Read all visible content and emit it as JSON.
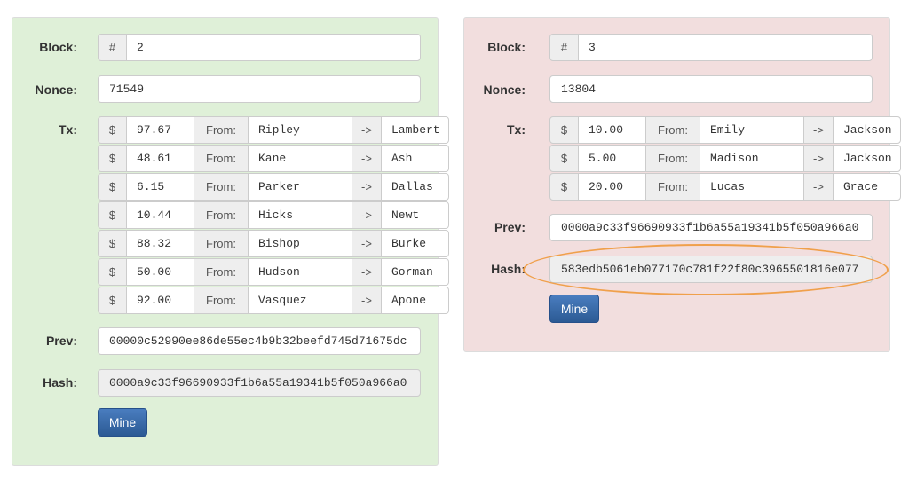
{
  "blocks": [
    {
      "block_label": "Block:",
      "block_prefix": "#",
      "block_number": "2",
      "nonce_label": "Nonce:",
      "nonce": "71549",
      "tx_label": "Tx:",
      "tx": [
        {
          "symbol": "$",
          "amount": "97.67",
          "from_label": "From:",
          "from": "Ripley",
          "arrow": "->",
          "to": "Lambert"
        },
        {
          "symbol": "$",
          "amount": "48.61",
          "from_label": "From:",
          "from": "Kane",
          "arrow": "->",
          "to": "Ash"
        },
        {
          "symbol": "$",
          "amount": "6.15",
          "from_label": "From:",
          "from": "Parker",
          "arrow": "->",
          "to": "Dallas"
        },
        {
          "symbol": "$",
          "amount": "10.44",
          "from_label": "From:",
          "from": "Hicks",
          "arrow": "->",
          "to": "Newt"
        },
        {
          "symbol": "$",
          "amount": "88.32",
          "from_label": "From:",
          "from": "Bishop",
          "arrow": "->",
          "to": "Burke"
        },
        {
          "symbol": "$",
          "amount": "50.00",
          "from_label": "From:",
          "from": "Hudson",
          "arrow": "->",
          "to": "Gorman"
        },
        {
          "symbol": "$",
          "amount": "92.00",
          "from_label": "From:",
          "from": "Vasquez",
          "arrow": "->",
          "to": "Apone"
        }
      ],
      "prev_label": "Prev:",
      "prev": "00000c52990ee86de55ec4b9b32beefd745d71675dc",
      "hash_label": "Hash:",
      "hash": "0000a9c33f96690933f1b6a55a19341b5f050a966a0",
      "mine_label": "Mine",
      "status_color": "#dff0d8"
    },
    {
      "block_label": "Block:",
      "block_prefix": "#",
      "block_number": "3",
      "nonce_label": "Nonce:",
      "nonce": "13804",
      "tx_label": "Tx:",
      "tx": [
        {
          "symbol": "$",
          "amount": "10.00",
          "from_label": "From:",
          "from": "Emily",
          "arrow": "->",
          "to": "Jackson"
        },
        {
          "symbol": "$",
          "amount": "5.00",
          "from_label": "From:",
          "from": "Madison",
          "arrow": "->",
          "to": "Jackson"
        },
        {
          "symbol": "$",
          "amount": "20.00",
          "from_label": "From:",
          "from": "Lucas",
          "arrow": "->",
          "to": "Grace"
        }
      ],
      "prev_label": "Prev:",
      "prev": "0000a9c33f96690933f1b6a55a19341b5f050a966a0",
      "hash_label": "Hash:",
      "hash": "583edb5061eb077170c781f22f80c3965501816e077",
      "mine_label": "Mine",
      "status_color": "#f2dede"
    }
  ],
  "highlight_color": "#f0a04b"
}
